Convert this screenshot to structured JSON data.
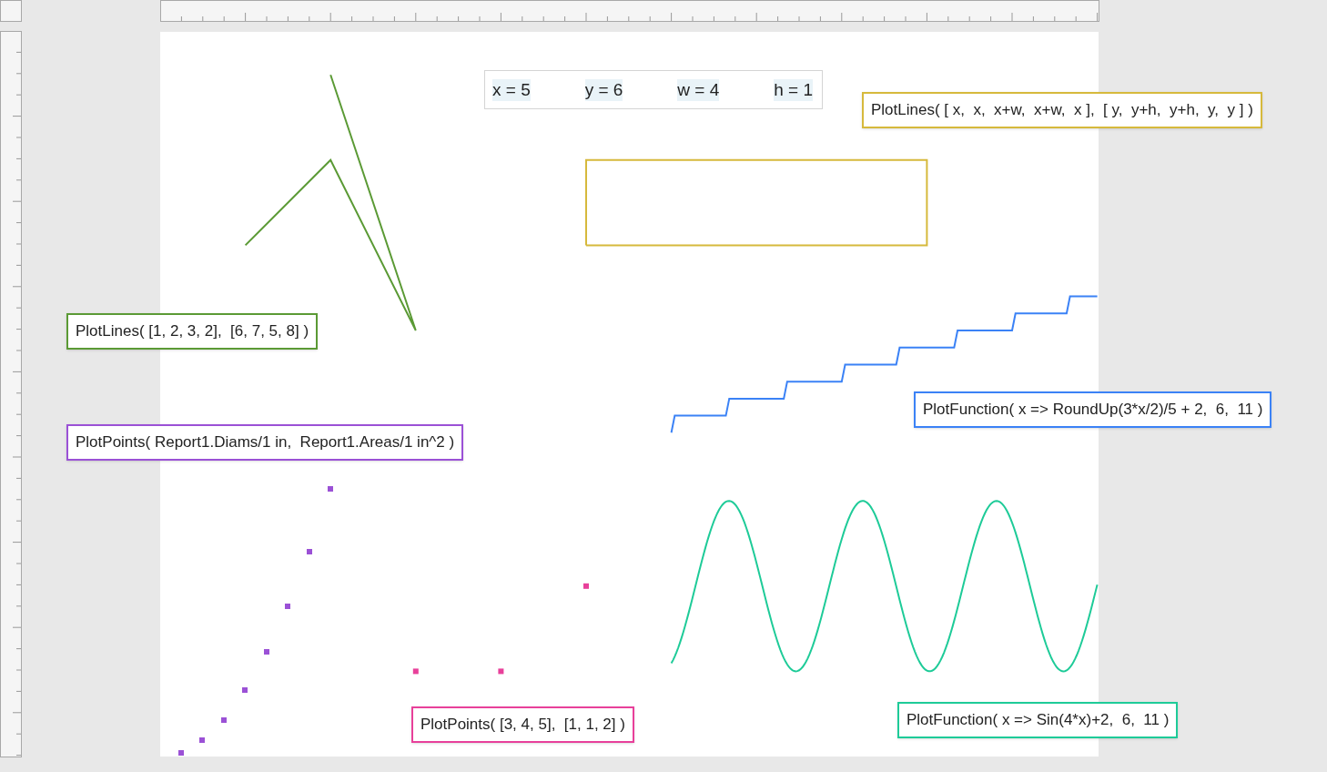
{
  "variables": [
    "x = 5",
    "y = 6",
    "w = 4",
    "h = 1"
  ],
  "formulas": [
    {
      "kind": "lines",
      "text": "PlotLines( [ x,  x,  x+w,  x+w,  x ],  [ y,  y+h,  y+h,  y,  y ] )",
      "color": "#d6b93c"
    },
    {
      "kind": "lines",
      "text": "PlotLines( [1, 2, 3, 2],  [6, 7, 5, 8] )",
      "color": "#5b9a35"
    },
    {
      "kind": "function",
      "text": "PlotFunction( x => RoundUp(3*x/2)/5 + 2,  6,  11 )",
      "color": "#3b82f6"
    },
    {
      "kind": "points",
      "text": "PlotPoints( Report1.Diams/1 in,  Report1.Areas/1 in^2 )",
      "color": "#9b51d6"
    },
    {
      "kind": "points",
      "text": "PlotPoints( [3, 4, 5],  [1, 1, 2] )",
      "color": "#e8409a"
    },
    {
      "kind": "function",
      "text": "PlotFunction( x => Sin(4*x)+2,  6,  11 )",
      "color": "#1ecb98"
    }
  ]
}
